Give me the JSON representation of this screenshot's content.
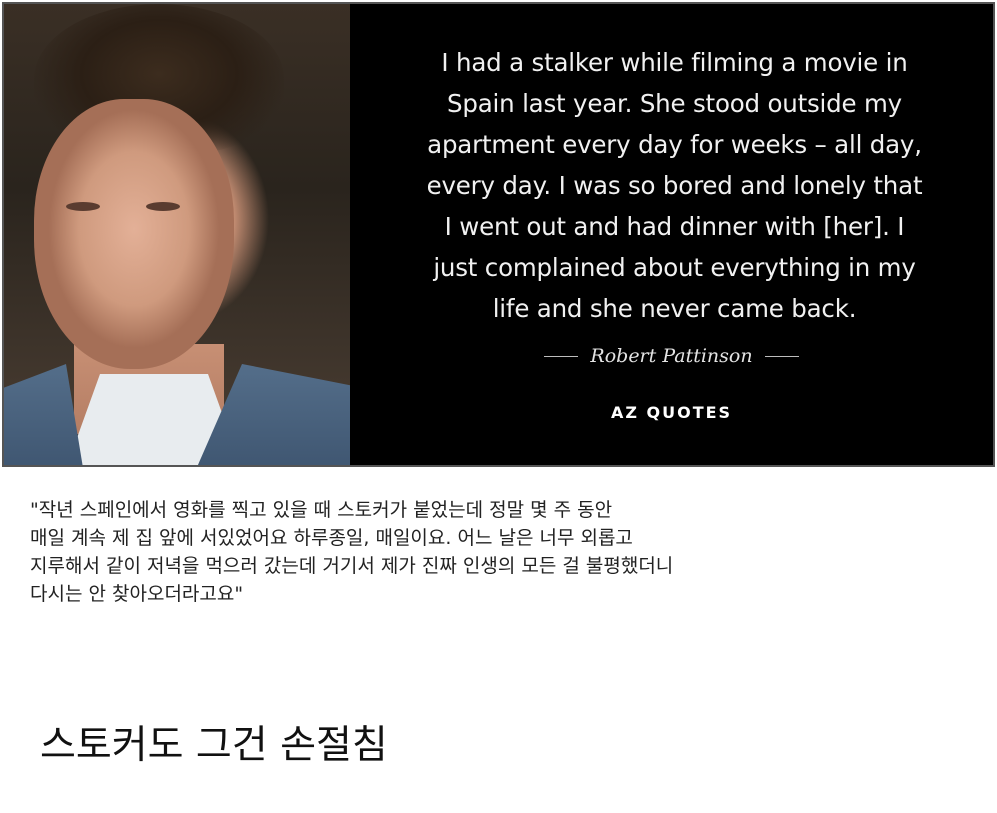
{
  "quote_card": {
    "quote": "I had a stalker while filming a movie in\nSpain last year. She stood outside my\napartment every day for weeks – all day,\nevery day. I was so bored and lonely that\nI went out and had dinner with [her]. I\njust complained about everything in my\nlife and she never came back.",
    "author": "Robert Pattinson",
    "brand": "AZ QUOTES"
  },
  "caption": {
    "translation": "\"작년 스페인에서 영화를 찍고 있을 때 스토커가 붙었는데 정말 몇 주 동안\n매일 계속 제 집 앞에 서있었어요 하루종일, 매일이요. 어느 날은 너무 외롭고\n지루해서 같이 저녁을 먹으러 갔는데 거기서 제가 진짜 인생의 모든 걸 불평했더니\n다시는 안 찾아오더라고요\""
  },
  "punchline": {
    "text": "스토커도 그건 손절침"
  }
}
